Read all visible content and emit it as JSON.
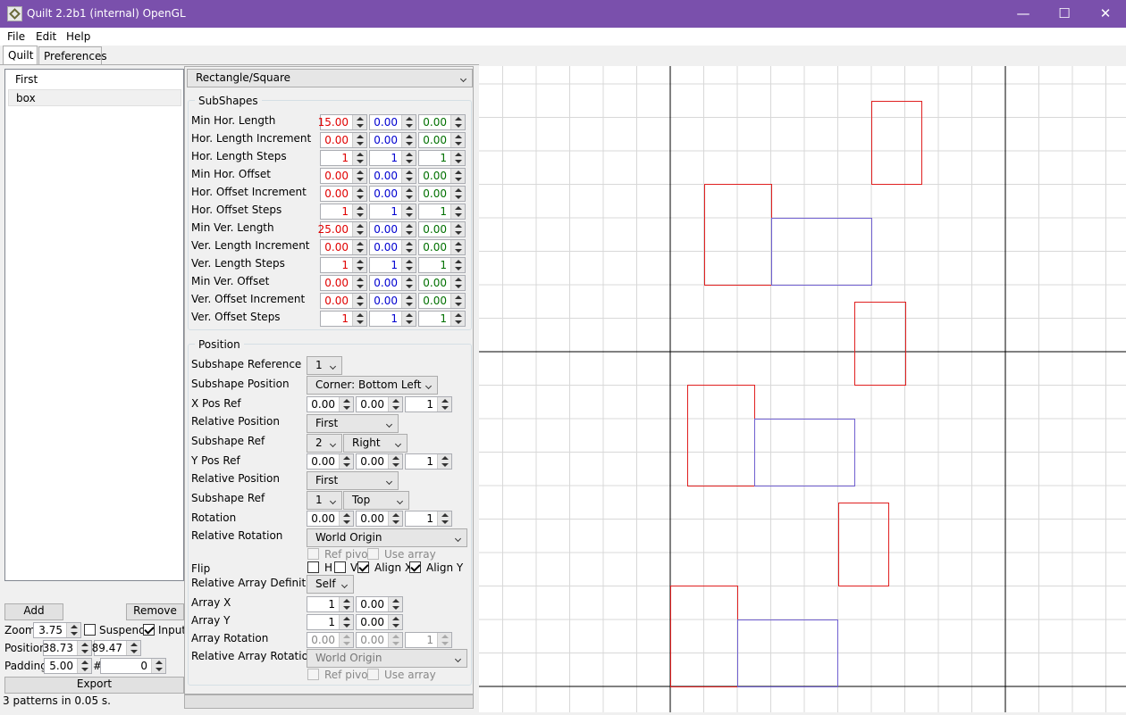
{
  "window": {
    "title": "Quilt 2.2b1 (internal) OpenGL",
    "minimize": "—",
    "maximize": "☐",
    "close": "✕"
  },
  "menu": [
    "File",
    "Edit",
    "Help"
  ],
  "tabs": [
    "Quilt",
    "Preferences"
  ],
  "patterns": [
    "First",
    "box"
  ],
  "buttons": {
    "add": "Add",
    "remove": "Remove",
    "export": "Export"
  },
  "controls": {
    "zoom_label": "Zoom",
    "zoom": "3.75",
    "suspend_label": "Suspend",
    "suspend": false,
    "input_label": "Input",
    "input": true,
    "position_label": "Position",
    "pos_x": "38.73",
    "pos_y": "89.47",
    "padding_label": "Padding",
    "padding": "5.00",
    "hash": "#",
    "count": "0"
  },
  "status": "3 patterns in 0.05 s.",
  "shape_type": "Rectangle/Square",
  "subshapes": {
    "title": "SubShapes",
    "rows": [
      {
        "label": "Min Hor. Length",
        "v": [
          "15.00",
          "0.00",
          "0.00"
        ]
      },
      {
        "label": "Hor. Length Increment",
        "v": [
          "0.00",
          "0.00",
          "0.00"
        ]
      },
      {
        "label": "Hor. Length Steps",
        "v": [
          "1",
          "1",
          "1"
        ]
      },
      {
        "label": "Min Hor. Offset",
        "v": [
          "0.00",
          "0.00",
          "0.00"
        ]
      },
      {
        "label": "Hor. Offset Increment",
        "v": [
          "0.00",
          "0.00",
          "0.00"
        ]
      },
      {
        "label": "Hor. Offset Steps",
        "v": [
          "1",
          "1",
          "1"
        ]
      },
      {
        "label": "Min Ver. Length",
        "v": [
          "25.00",
          "0.00",
          "0.00"
        ]
      },
      {
        "label": "Ver. Length Increment",
        "v": [
          "0.00",
          "0.00",
          "0.00"
        ]
      },
      {
        "label": "Ver. Length Steps",
        "v": [
          "1",
          "1",
          "1"
        ]
      },
      {
        "label": "Min Ver. Offset",
        "v": [
          "0.00",
          "0.00",
          "0.00"
        ]
      },
      {
        "label": "Ver. Offset Increment",
        "v": [
          "0.00",
          "0.00",
          "0.00"
        ]
      },
      {
        "label": "Ver. Offset Steps",
        "v": [
          "1",
          "1",
          "1"
        ]
      }
    ]
  },
  "position": {
    "title": "Position",
    "subshape_reference_label": "Subshape Reference",
    "subshape_reference": "1",
    "subshape_position_label": "Subshape Position",
    "subshape_position": "Corner: Bottom Left",
    "x_pos_ref_label": "X Pos Ref",
    "x_pos_ref": [
      "0.00",
      "0.00",
      "1"
    ],
    "x_relative_position_label": "Relative Position",
    "x_relative_position": "First",
    "x_subshape_ref_label": "Subshape Ref",
    "x_subshape_ref": "2",
    "x_subshape_side": "Right",
    "y_pos_ref_label": "Y Pos Ref",
    "y_pos_ref": [
      "0.00",
      "0.00",
      "1"
    ],
    "y_relative_position_label": "Relative Position",
    "y_relative_position": "First",
    "y_subshape_ref_label": "Subshape Ref",
    "y_subshape_ref": "1",
    "y_subshape_side": "Top",
    "rotation_label": "Rotation",
    "rotation": [
      "0.00",
      "0.00",
      "1"
    ],
    "relative_rotation_label": "Relative Rotation",
    "relative_rotation": "World Origin",
    "ref_pivot_label": "Ref pivot",
    "use_array_label": "Use array",
    "flip_label": "Flip",
    "flip_h_label": "H",
    "flip_v_label": "V",
    "align_x_label": "Align X",
    "align_y_label": "Align Y",
    "flip_h": false,
    "flip_v": false,
    "align_x": true,
    "align_y": true,
    "relative_array_definition_label": "Relative Array Definition",
    "relative_array_definition": "Self",
    "array_x_label": "Array X",
    "array_x": [
      "1",
      "0.00"
    ],
    "array_y_label": "Array Y",
    "array_y": [
      "1",
      "0.00"
    ],
    "array_rotation_label": "Array Rotation",
    "array_rotation": [
      "0.00",
      "0.00",
      "1"
    ],
    "relative_array_rotation_label": "Relative Array Rotation",
    "relative_array_rotation": "World Origin",
    "ref_pivot2_label": "Ref pivot",
    "use_array2_label": "Use array"
  },
  "colors": {
    "red": "#e00000",
    "blue": "#0000d0",
    "green": "#007000",
    "shape_red": "#e02020",
    "shape_blue": "#7060d0",
    "grid": "#d8d8d8",
    "axis": "#000000"
  }
}
